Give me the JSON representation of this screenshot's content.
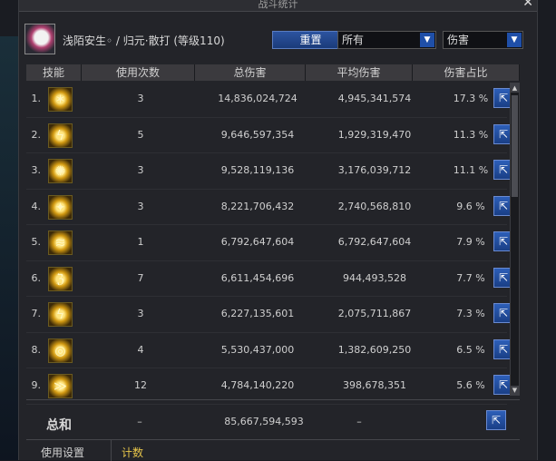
{
  "window": {
    "title": "战斗统计",
    "close_label": "✕"
  },
  "player": {
    "name": "浅陌安生◦ / 归元·散打 (等级110)"
  },
  "controls": {
    "reset_label": "重置",
    "filter_value": "所有",
    "metric_value": "伤害"
  },
  "table": {
    "headers": [
      "技能",
      "使用次数",
      "总伤害",
      "平均伤害",
      "伤害占比"
    ],
    "rows": [
      {
        "index": "1.",
        "uses": "3",
        "total": "14,836,024,724",
        "average": "4,945,341,574",
        "percent": "17.3 %"
      },
      {
        "index": "2.",
        "uses": "5",
        "total": "9,646,597,354",
        "average": "1,929,319,470",
        "percent": "11.3 %"
      },
      {
        "index": "3.",
        "uses": "3",
        "total": "9,528,119,136",
        "average": "3,176,039,712",
        "percent": "11.1 %"
      },
      {
        "index": "4.",
        "uses": "3",
        "total": "8,221,706,432",
        "average": "2,740,568,810",
        "percent": "9.6 %"
      },
      {
        "index": "5.",
        "uses": "1",
        "total": "6,792,647,604",
        "average": "6,792,647,604",
        "percent": "7.9 %"
      },
      {
        "index": "6.",
        "uses": "7",
        "total": "6,611,454,696",
        "average": "944,493,528",
        "percent": "7.7 %"
      },
      {
        "index": "7.",
        "uses": "3",
        "total": "6,227,135,601",
        "average": "2,075,711,867",
        "percent": "7.3 %"
      },
      {
        "index": "8.",
        "uses": "4",
        "total": "5,530,437,000",
        "average": "1,382,609,250",
        "percent": "6.5 %"
      },
      {
        "index": "9.",
        "uses": "12",
        "total": "4,784,140,220",
        "average": "398,678,351",
        "percent": "5.6 %"
      }
    ]
  },
  "summary": {
    "label": "总和",
    "uses": "–",
    "total": "85,667,594,593",
    "average": "–"
  },
  "bottom_tabs": [
    "使用设置",
    "计数"
  ],
  "icons": {
    "skill_glyphs": [
      "✶",
      "ϟ",
      "✺",
      "✦",
      "≋",
      "ℨ",
      "ϟ",
      "◎",
      "≫"
    ]
  },
  "colors": {
    "accent": "#1f4fa8",
    "active_tab": "#e8c64a"
  }
}
